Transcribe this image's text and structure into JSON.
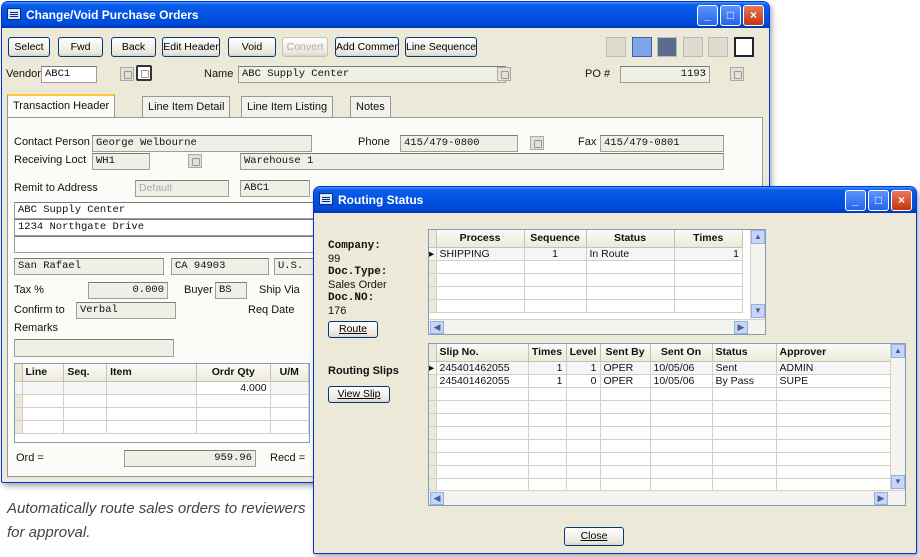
{
  "caption": "Automatically route sales orders to reviewers for approval.",
  "main": {
    "title": "Change/Void Purchase Orders",
    "toolbar": [
      "Select",
      "Fwd",
      "Back",
      "Edit Header",
      "Void",
      "Convert",
      "Add Comment",
      "Line Sequence"
    ],
    "vendor_label": "Vendor",
    "vendor_value": "ABC1",
    "name_label": "Name",
    "name_value": "ABC Supply Center",
    "po_label": "PO #",
    "po_value": "1193",
    "tabs": [
      "Transaction Header",
      "Line Item Detail",
      "Line Item Listing",
      "Notes"
    ],
    "contact_label": "Contact Person",
    "contact_value": "George Welbourne",
    "phone_label": "Phone",
    "phone_value": "415/479-0800",
    "fax_label": "Fax",
    "fax_value": "415/479-0801",
    "receiving_label": "Receiving Loct",
    "receiving_code": "WH1",
    "receiving_name": "Warehouse 1",
    "remit_label": "Remit to Address",
    "remit_select": "Default",
    "remit_code": "ABC1",
    "address_lines": [
      "ABC Supply Center",
      "1234 Northgate Drive",
      ""
    ],
    "city": "San Rafael",
    "state_zip": "CA  94903",
    "country": "U.S.",
    "tax_label": "Tax %",
    "tax_value": "0.000",
    "buyer_label": "Buyer",
    "buyer_value": "BS",
    "shipvia_label": "Ship Via",
    "confirm_label": "Confirm to",
    "confirm_value": "Verbal",
    "reqdate_label": "Req Date",
    "remarks_label": "Remarks",
    "line_headers": [
      "Line",
      "Seq.",
      "Item",
      "Ordr Qty",
      "U/M"
    ],
    "line_qty": "4.000",
    "ord_label": "Ord =",
    "ord_value": "959.96",
    "recd_label": "Recd ="
  },
  "routing": {
    "title": "Routing Status",
    "company_label": "Company:",
    "company_value": "99",
    "doctype_label": "Doc.Type:",
    "doctype_value": "Sales Order",
    "docno_label": "Doc.NO:",
    "docno_value": "176",
    "route_button": "Route",
    "process_headers": [
      "Process",
      "Sequence",
      "Status",
      "Times"
    ],
    "process_rows": [
      [
        "SHIPPING",
        "1",
        "In Route",
        "1"
      ]
    ],
    "slips_label": "Routing Slips",
    "view_slip_button": "View Slip",
    "slip_headers": [
      "Slip No.",
      "Times",
      "Level",
      "Sent By",
      "Sent On",
      "Status",
      "Approver"
    ],
    "slip_rows": [
      [
        "245401462055",
        "1",
        "1",
        "OPER",
        "10/05/06",
        "Sent",
        "ADMIN"
      ],
      [
        "245401462055",
        "1",
        "0",
        "OPER",
        "10/05/06",
        "By Pass",
        "SUPE"
      ]
    ],
    "close_button": "Close"
  }
}
